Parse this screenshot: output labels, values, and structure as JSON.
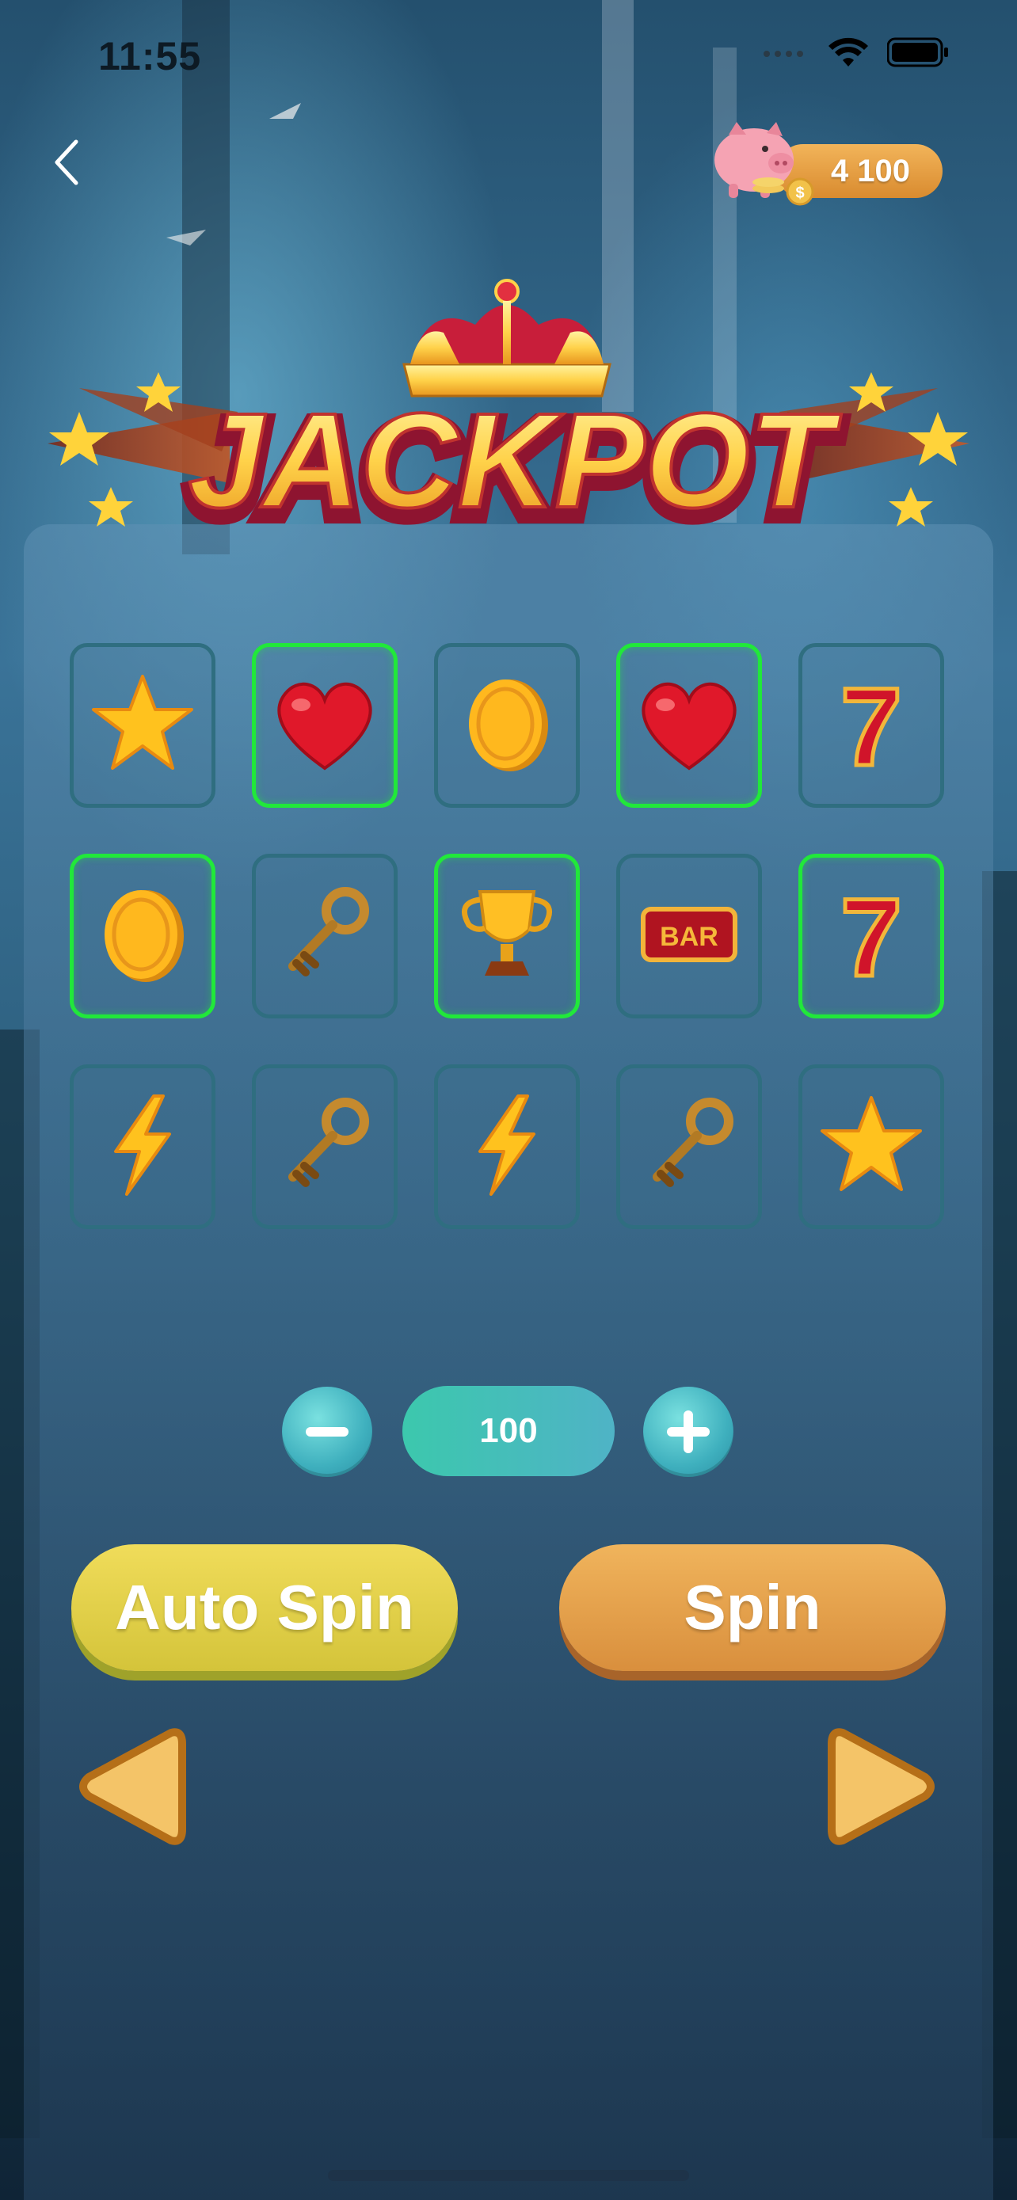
{
  "status_bar": {
    "time": "11:55",
    "signal_icon": "cellular-signal-icon",
    "wifi_icon": "wifi-icon",
    "battery_icon": "battery-icon"
  },
  "header": {
    "back_icon": "chevron-left-icon",
    "bank_icon": "piggy-bank-icon",
    "coins": "4 100"
  },
  "logo": {
    "text": "JACKPOT",
    "crown_icon": "crown-icon",
    "star_icon": "star-icon"
  },
  "reels": {
    "rows": [
      [
        {
          "symbol": "star",
          "icon": "star-icon",
          "win": false
        },
        {
          "symbol": "heart",
          "icon": "heart-icon",
          "win": true
        },
        {
          "symbol": "coin",
          "icon": "coin-icon",
          "win": false
        },
        {
          "symbol": "heart",
          "icon": "heart-icon",
          "win": true
        },
        {
          "symbol": "seven",
          "icon": "seven-icon",
          "label": "7",
          "win": false
        }
      ],
      [
        {
          "symbol": "coin",
          "icon": "coin-icon",
          "win": true
        },
        {
          "symbol": "key",
          "icon": "key-icon",
          "win": false
        },
        {
          "symbol": "trophy",
          "icon": "trophy-icon",
          "win": true
        },
        {
          "symbol": "bar",
          "icon": "bar-icon",
          "label": "BAR",
          "win": false
        },
        {
          "symbol": "seven",
          "icon": "seven-icon",
          "label": "7",
          "win": true
        }
      ],
      [
        {
          "symbol": "lightning",
          "icon": "lightning-icon",
          "win": false
        },
        {
          "symbol": "key",
          "icon": "key-icon",
          "win": false
        },
        {
          "symbol": "lightning",
          "icon": "lightning-icon",
          "win": false
        },
        {
          "symbol": "key",
          "icon": "key-icon",
          "win": false
        },
        {
          "symbol": "star",
          "icon": "star-icon",
          "win": false
        }
      ]
    ],
    "win_color": "#21e83a"
  },
  "bet": {
    "value": "100",
    "minus_icon": "minus-icon",
    "plus_icon": "plus-icon"
  },
  "buttons": {
    "auto_spin": "Auto Spin",
    "spin": "Spin"
  },
  "nav": {
    "prev_icon": "triangle-left-icon",
    "next_icon": "triangle-right-icon"
  },
  "colors": {
    "auto_spin": "#e2d24a",
    "spin": "#e4a04c",
    "bank_pill": "#e6a043",
    "stepper": "#3fb0be"
  }
}
